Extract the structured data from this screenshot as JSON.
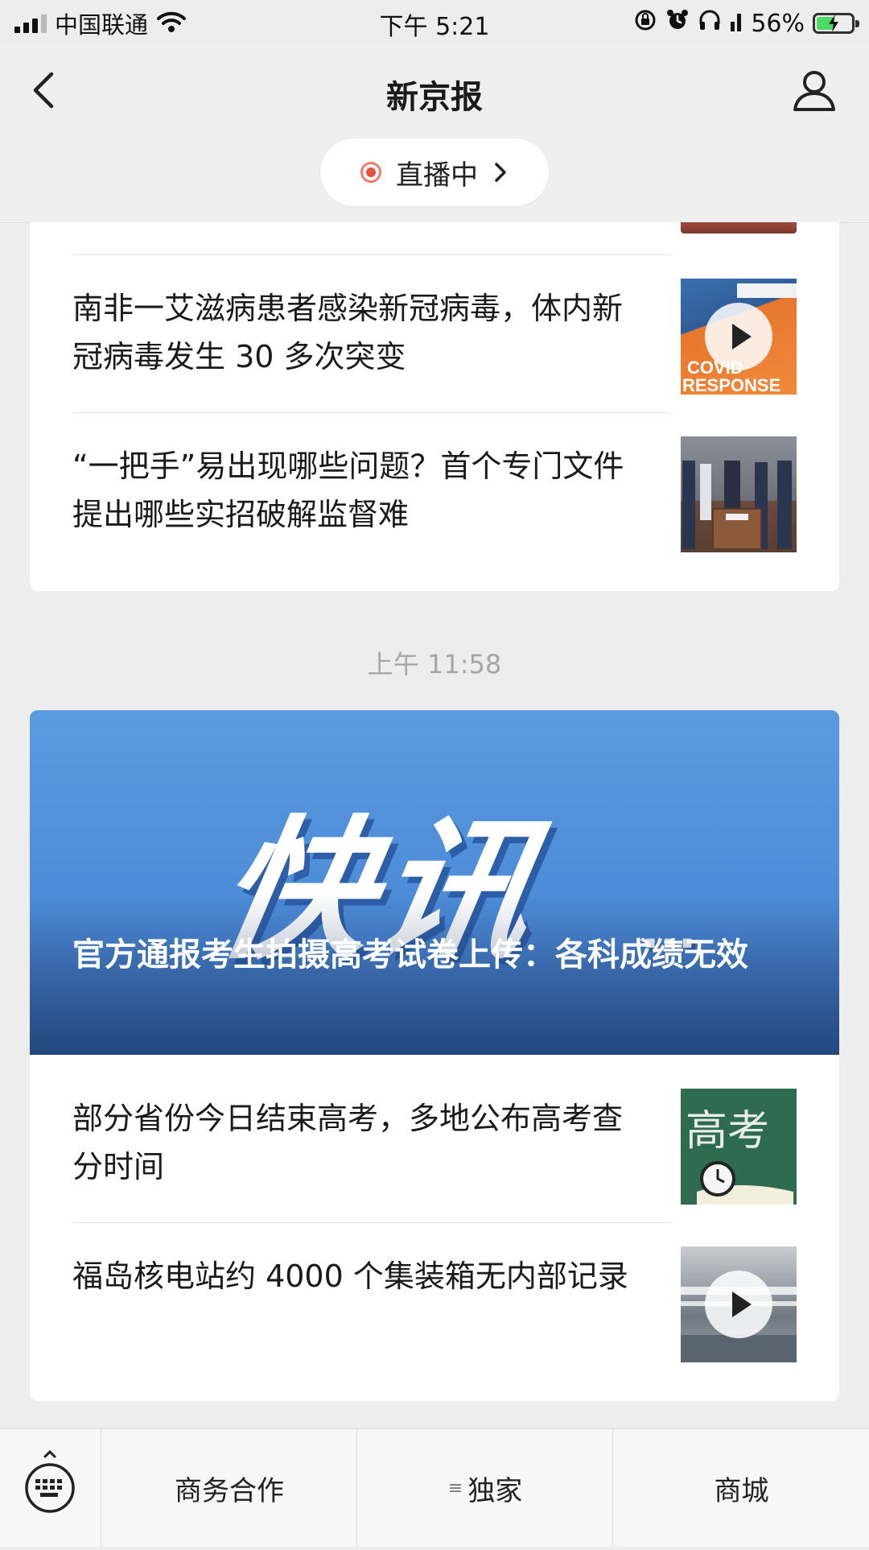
{
  "status_bar": {
    "carrier": "中国联通",
    "time": "下午 5:21",
    "battery": "56%",
    "battery_level": 0.56
  },
  "header": {
    "title": "新京报",
    "live_label": "直播中",
    "live_chevron": "›"
  },
  "feed_group_1": {
    "articles": [
      {
        "title": "南非一艾滋病患者感染新冠病毒，体内新冠病毒发生 30 多次突变",
        "has_video": true
      },
      {
        "title": "“一把手”易出现哪些问题？首个专门文件提出哪些实招破解监督难",
        "has_video": false
      }
    ]
  },
  "timestamp": "上午 11:58",
  "feed_group_2": {
    "headline": {
      "image_text": "快讯",
      "image_dots": "...",
      "title": "官方通报考生拍摄高考试卷上传：各科成绩无效"
    },
    "articles": [
      {
        "title": "部分省份今日结束高考，多地公布高考查分时间",
        "thumb_text": "高考",
        "has_video": false
      },
      {
        "title": "福岛核电站约 4000 个集装箱无内部记录",
        "has_video": true
      }
    ]
  },
  "bottom_bar": {
    "items": [
      {
        "label": "商务合作"
      },
      {
        "label": "独家",
        "menu_mark": "≡"
      },
      {
        "label": "商城"
      }
    ]
  },
  "colors": {
    "background": "#ededed",
    "live_dot": "#e8503a",
    "hero_blue": "#4c8ad6"
  }
}
